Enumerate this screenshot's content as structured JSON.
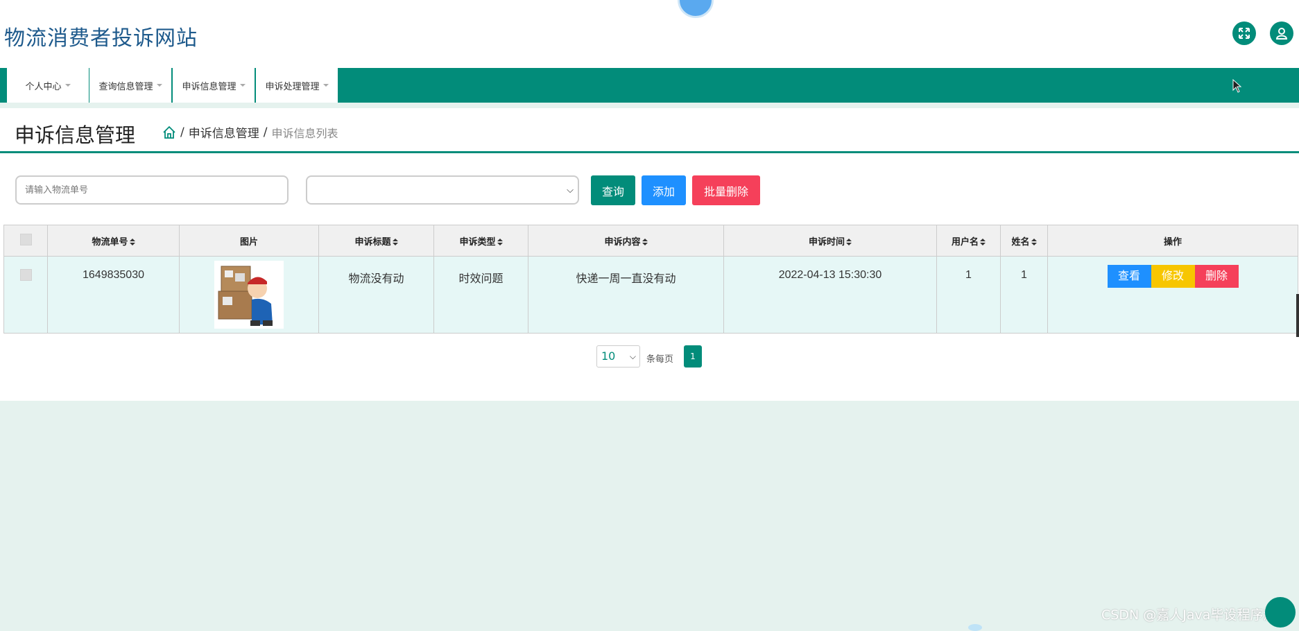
{
  "site": {
    "title": "物流消费者投诉网站"
  },
  "nav": {
    "items": [
      {
        "label": "个人中心"
      },
      {
        "label": "查询信息管理"
      },
      {
        "label": "申诉信息管理"
      },
      {
        "label": "申诉处理管理"
      }
    ]
  },
  "page": {
    "title": "申诉信息管理",
    "breadcrumb": {
      "sep": "/",
      "section": "申诉信息管理",
      "current": "申诉信息列表"
    }
  },
  "search": {
    "input_placeholder": "请输入物流单号",
    "select_value": "",
    "query_label": "查询",
    "add_label": "添加",
    "batch_delete_label": "批量删除"
  },
  "table": {
    "headers": [
      "物流单号",
      "图片",
      "申诉标题",
      "申诉类型",
      "申诉内容",
      "申诉时间",
      "用户名",
      "姓名",
      "操作"
    ],
    "rows": [
      {
        "tracking_no": "1649835030",
        "title": "物流没有动",
        "type": "时效问题",
        "content": "快递一周一直没有动",
        "time": "2022-04-13 15:30:30",
        "username": "1",
        "name": "1",
        "image_icon": "delivery-person-image"
      }
    ],
    "actions": {
      "view": "查看",
      "edit": "修改",
      "delete": "删除"
    }
  },
  "pagination": {
    "page_size": "10",
    "per_page_label": "条每页",
    "current_page": "1"
  },
  "watermark": "CSDN @嘉人Java毕设程序源码",
  "colors": {
    "primary": "#028c7a",
    "blue": "#1e90ff",
    "red": "#f44336",
    "yellow": "#f7c600",
    "pink": "#f5405a",
    "title_blue": "#1e5a8c",
    "row_bg": "#e6f7f6",
    "page_bg": "#e5f2ee"
  }
}
